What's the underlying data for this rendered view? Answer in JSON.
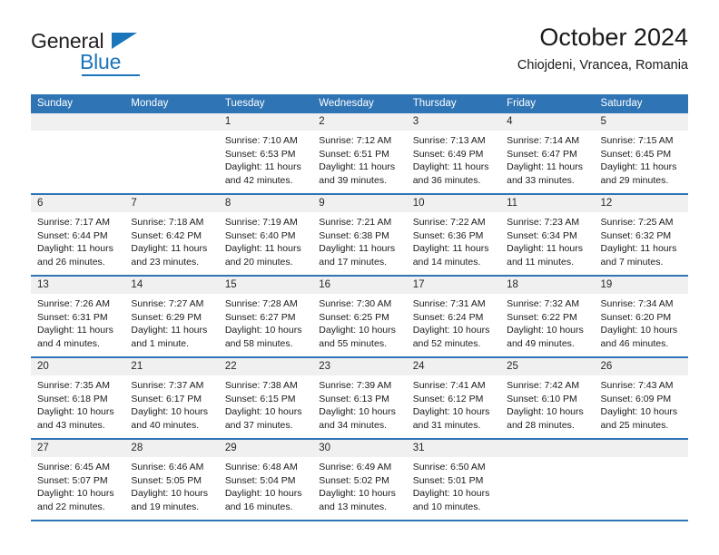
{
  "logo": {
    "word1": "General",
    "word2": "Blue",
    "triangle_color": "#1b75bb"
  },
  "header": {
    "title": "October 2024",
    "subtitle": "Chiojdeni, Vrancea, Romania"
  },
  "theme": {
    "header_blue": "#2f74b5",
    "daynum_bg": "#f0f0f0",
    "text": "#1a1a1a"
  },
  "calendar": {
    "weekday_headers": [
      "Sunday",
      "Monday",
      "Tuesday",
      "Wednesday",
      "Thursday",
      "Friday",
      "Saturday"
    ],
    "weeks": [
      [
        {
          "day": "",
          "sunrise": "",
          "sunset": "",
          "daylight_a": "",
          "daylight_b": ""
        },
        {
          "day": "",
          "sunrise": "",
          "sunset": "",
          "daylight_a": "",
          "daylight_b": ""
        },
        {
          "day": "1",
          "sunrise": "Sunrise: 7:10 AM",
          "sunset": "Sunset: 6:53 PM",
          "daylight_a": "Daylight: 11 hours",
          "daylight_b": "and 42 minutes."
        },
        {
          "day": "2",
          "sunrise": "Sunrise: 7:12 AM",
          "sunset": "Sunset: 6:51 PM",
          "daylight_a": "Daylight: 11 hours",
          "daylight_b": "and 39 minutes."
        },
        {
          "day": "3",
          "sunrise": "Sunrise: 7:13 AM",
          "sunset": "Sunset: 6:49 PM",
          "daylight_a": "Daylight: 11 hours",
          "daylight_b": "and 36 minutes."
        },
        {
          "day": "4",
          "sunrise": "Sunrise: 7:14 AM",
          "sunset": "Sunset: 6:47 PM",
          "daylight_a": "Daylight: 11 hours",
          "daylight_b": "and 33 minutes."
        },
        {
          "day": "5",
          "sunrise": "Sunrise: 7:15 AM",
          "sunset": "Sunset: 6:45 PM",
          "daylight_a": "Daylight: 11 hours",
          "daylight_b": "and 29 minutes."
        }
      ],
      [
        {
          "day": "6",
          "sunrise": "Sunrise: 7:17 AM",
          "sunset": "Sunset: 6:44 PM",
          "daylight_a": "Daylight: 11 hours",
          "daylight_b": "and 26 minutes."
        },
        {
          "day": "7",
          "sunrise": "Sunrise: 7:18 AM",
          "sunset": "Sunset: 6:42 PM",
          "daylight_a": "Daylight: 11 hours",
          "daylight_b": "and 23 minutes."
        },
        {
          "day": "8",
          "sunrise": "Sunrise: 7:19 AM",
          "sunset": "Sunset: 6:40 PM",
          "daylight_a": "Daylight: 11 hours",
          "daylight_b": "and 20 minutes."
        },
        {
          "day": "9",
          "sunrise": "Sunrise: 7:21 AM",
          "sunset": "Sunset: 6:38 PM",
          "daylight_a": "Daylight: 11 hours",
          "daylight_b": "and 17 minutes."
        },
        {
          "day": "10",
          "sunrise": "Sunrise: 7:22 AM",
          "sunset": "Sunset: 6:36 PM",
          "daylight_a": "Daylight: 11 hours",
          "daylight_b": "and 14 minutes."
        },
        {
          "day": "11",
          "sunrise": "Sunrise: 7:23 AM",
          "sunset": "Sunset: 6:34 PM",
          "daylight_a": "Daylight: 11 hours",
          "daylight_b": "and 11 minutes."
        },
        {
          "day": "12",
          "sunrise": "Sunrise: 7:25 AM",
          "sunset": "Sunset: 6:32 PM",
          "daylight_a": "Daylight: 11 hours",
          "daylight_b": "and 7 minutes."
        }
      ],
      [
        {
          "day": "13",
          "sunrise": "Sunrise: 7:26 AM",
          "sunset": "Sunset: 6:31 PM",
          "daylight_a": "Daylight: 11 hours",
          "daylight_b": "and 4 minutes."
        },
        {
          "day": "14",
          "sunrise": "Sunrise: 7:27 AM",
          "sunset": "Sunset: 6:29 PM",
          "daylight_a": "Daylight: 11 hours",
          "daylight_b": "and 1 minute."
        },
        {
          "day": "15",
          "sunrise": "Sunrise: 7:28 AM",
          "sunset": "Sunset: 6:27 PM",
          "daylight_a": "Daylight: 10 hours",
          "daylight_b": "and 58 minutes."
        },
        {
          "day": "16",
          "sunrise": "Sunrise: 7:30 AM",
          "sunset": "Sunset: 6:25 PM",
          "daylight_a": "Daylight: 10 hours",
          "daylight_b": "and 55 minutes."
        },
        {
          "day": "17",
          "sunrise": "Sunrise: 7:31 AM",
          "sunset": "Sunset: 6:24 PM",
          "daylight_a": "Daylight: 10 hours",
          "daylight_b": "and 52 minutes."
        },
        {
          "day": "18",
          "sunrise": "Sunrise: 7:32 AM",
          "sunset": "Sunset: 6:22 PM",
          "daylight_a": "Daylight: 10 hours",
          "daylight_b": "and 49 minutes."
        },
        {
          "day": "19",
          "sunrise": "Sunrise: 7:34 AM",
          "sunset": "Sunset: 6:20 PM",
          "daylight_a": "Daylight: 10 hours",
          "daylight_b": "and 46 minutes."
        }
      ],
      [
        {
          "day": "20",
          "sunrise": "Sunrise: 7:35 AM",
          "sunset": "Sunset: 6:18 PM",
          "daylight_a": "Daylight: 10 hours",
          "daylight_b": "and 43 minutes."
        },
        {
          "day": "21",
          "sunrise": "Sunrise: 7:37 AM",
          "sunset": "Sunset: 6:17 PM",
          "daylight_a": "Daylight: 10 hours",
          "daylight_b": "and 40 minutes."
        },
        {
          "day": "22",
          "sunrise": "Sunrise: 7:38 AM",
          "sunset": "Sunset: 6:15 PM",
          "daylight_a": "Daylight: 10 hours",
          "daylight_b": "and 37 minutes."
        },
        {
          "day": "23",
          "sunrise": "Sunrise: 7:39 AM",
          "sunset": "Sunset: 6:13 PM",
          "daylight_a": "Daylight: 10 hours",
          "daylight_b": "and 34 minutes."
        },
        {
          "day": "24",
          "sunrise": "Sunrise: 7:41 AM",
          "sunset": "Sunset: 6:12 PM",
          "daylight_a": "Daylight: 10 hours",
          "daylight_b": "and 31 minutes."
        },
        {
          "day": "25",
          "sunrise": "Sunrise: 7:42 AM",
          "sunset": "Sunset: 6:10 PM",
          "daylight_a": "Daylight: 10 hours",
          "daylight_b": "and 28 minutes."
        },
        {
          "day": "26",
          "sunrise": "Sunrise: 7:43 AM",
          "sunset": "Sunset: 6:09 PM",
          "daylight_a": "Daylight: 10 hours",
          "daylight_b": "and 25 minutes."
        }
      ],
      [
        {
          "day": "27",
          "sunrise": "Sunrise: 6:45 AM",
          "sunset": "Sunset: 5:07 PM",
          "daylight_a": "Daylight: 10 hours",
          "daylight_b": "and 22 minutes."
        },
        {
          "day": "28",
          "sunrise": "Sunrise: 6:46 AM",
          "sunset": "Sunset: 5:05 PM",
          "daylight_a": "Daylight: 10 hours",
          "daylight_b": "and 19 minutes."
        },
        {
          "day": "29",
          "sunrise": "Sunrise: 6:48 AM",
          "sunset": "Sunset: 5:04 PM",
          "daylight_a": "Daylight: 10 hours",
          "daylight_b": "and 16 minutes."
        },
        {
          "day": "30",
          "sunrise": "Sunrise: 6:49 AM",
          "sunset": "Sunset: 5:02 PM",
          "daylight_a": "Daylight: 10 hours",
          "daylight_b": "and 13 minutes."
        },
        {
          "day": "31",
          "sunrise": "Sunrise: 6:50 AM",
          "sunset": "Sunset: 5:01 PM",
          "daylight_a": "Daylight: 10 hours",
          "daylight_b": "and 10 minutes."
        },
        {
          "day": "",
          "sunrise": "",
          "sunset": "",
          "daylight_a": "",
          "daylight_b": ""
        },
        {
          "day": "",
          "sunrise": "",
          "sunset": "",
          "daylight_a": "",
          "daylight_b": ""
        }
      ]
    ]
  }
}
